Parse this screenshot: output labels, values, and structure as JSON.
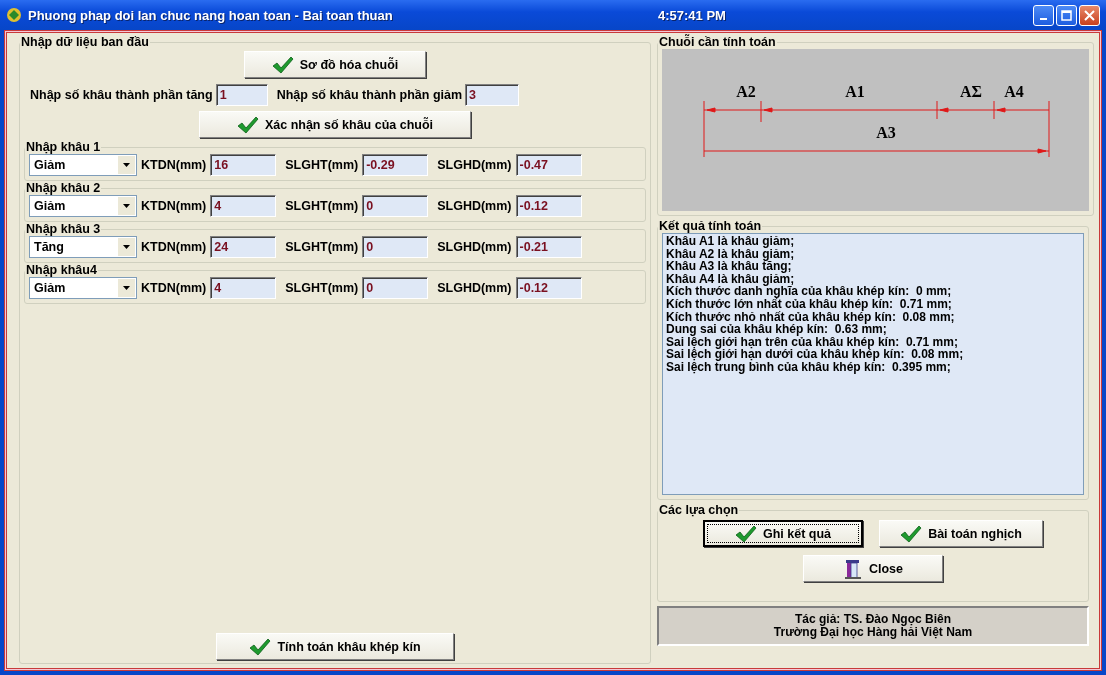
{
  "window": {
    "title": "Phuong phap doi lan chuc nang hoan toan - Bai toan thuan",
    "clock": "4:57:41 PM"
  },
  "input_group": {
    "title": "Nhập dữ liệu ban đầu",
    "diagram_button": "Sơ đồ hóa chuỗi",
    "increasing_label": "Nhập số khâu thành phần tăng",
    "increasing_count": "1",
    "decreasing_label": "Nhập số khâu thành phần giảm",
    "decreasing_count": "3",
    "confirm_button": "Xác nhận số khâu của chuỗi",
    "links": [
      {
        "title": "Nhập khâu 1",
        "type": "Giảm",
        "ktdn_label": "KTDN(mm)",
        "ktdn": "16",
        "slght_label": "SLGHT(mm)",
        "slght": "-0.29",
        "slghd_label": "SLGHD(mm)",
        "slghd": "-0.47"
      },
      {
        "title": "Nhập khâu 2",
        "type": "Giảm",
        "ktdn_label": "KTDN(mm)",
        "ktdn": "4",
        "slght_label": "SLGHT(mm)",
        "slght": "0",
        "slghd_label": "SLGHD(mm)",
        "slghd": "-0.12"
      },
      {
        "title": "Nhập khâu 3",
        "type": "Tăng",
        "ktdn_label": "KTDN(mm)",
        "ktdn": "24",
        "slght_label": "SLGHT(mm)",
        "slght": "0",
        "slghd_label": "SLGHD(mm)",
        "slghd": "-0.21"
      },
      {
        "title": "Nhập khâu4",
        "type": "Giảm",
        "ktdn_label": "KTDN(mm)",
        "ktdn": "4",
        "slght_label": "SLGHT(mm)",
        "slght": "0",
        "slghd_label": "SLGHD(mm)",
        "slghd": "-0.12"
      }
    ],
    "calculate_button": "Tính toán khâu khép kín"
  },
  "chain": {
    "title": "Chuỗi cần tính toán",
    "segments": [
      {
        "label": "A2",
        "kind": "decreasing"
      },
      {
        "label": "A1",
        "kind": "decreasing"
      },
      {
        "label": "AΣ",
        "kind": "decreasing"
      },
      {
        "label": "A4",
        "kind": "decreasing"
      },
      {
        "label": "A3",
        "kind": "increasing"
      }
    ]
  },
  "results": {
    "title": "Kết quả tính toán",
    "lines": [
      "Khâu A1 là khâu giảm;",
      "Khâu A2 là khâu giảm;",
      "Khâu A3 là khâu tăng;",
      "Khâu A4 là khâu giảm;",
      "Kích thước danh nghĩa của khâu khép kín:  0 mm;",
      "Kích thước lớn nhất của khâu khép kín:  0.71 mm;",
      "Kích thước nhỏ nhất của khâu khép kín:  0.08 mm;",
      "Dung sai của khâu khép kín:  0.63 mm;",
      "Sai lệch giới hạn trên của khâu khép kín:  0.71 mm;",
      "Sai lệch giới hạn dưới của khâu khép kín:  0.08 mm;",
      "Sai lệch trung bình của khâu khép kín:  0.395 mm;"
    ]
  },
  "options": {
    "title": "Các lựa chọn",
    "buttons": [
      {
        "label": "Ghi kết quả",
        "kind": "check",
        "focused": true
      },
      {
        "label": "Bài toán nghịch",
        "kind": "check",
        "focused": false
      },
      {
        "label": "Close",
        "kind": "door",
        "focused": false
      }
    ]
  },
  "author": {
    "lines": [
      "Tác giả: TS. Đào Ngọc Biên",
      "Trường Đại học Hàng hải Việt Nam"
    ]
  }
}
